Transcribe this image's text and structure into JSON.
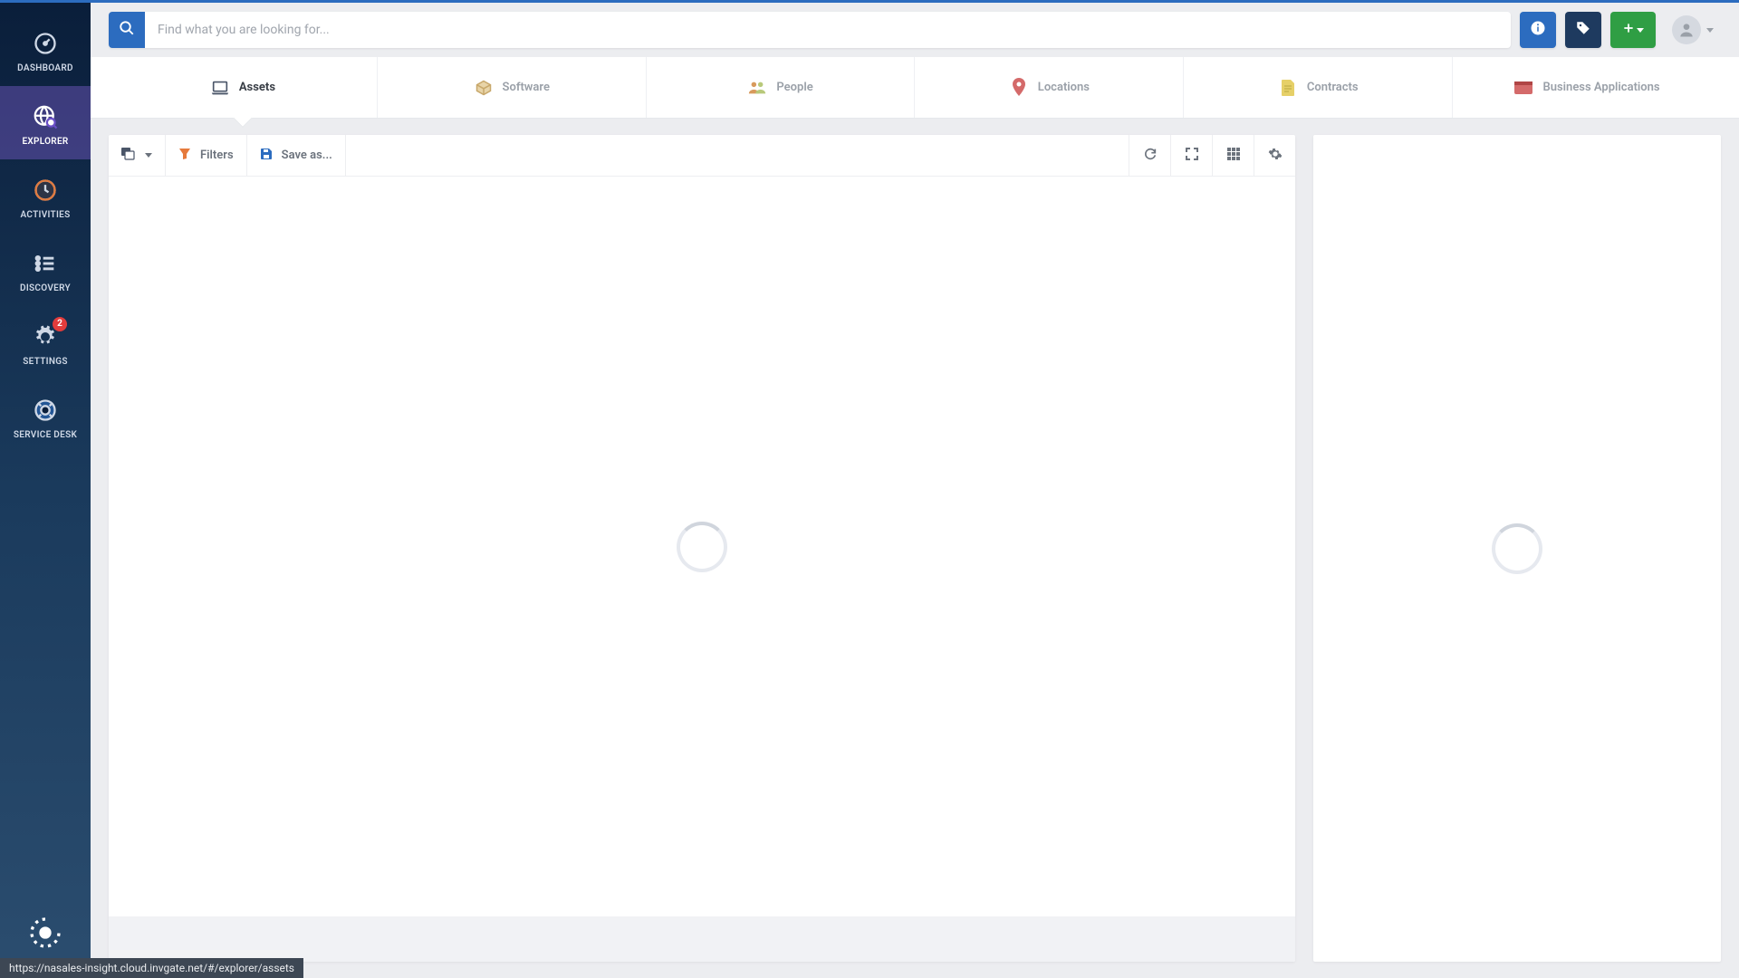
{
  "search": {
    "placeholder": "Find what you are looking for..."
  },
  "sidebar": {
    "items": [
      {
        "label": "DASHBOARD"
      },
      {
        "label": "EXPLORER"
      },
      {
        "label": "ACTIVITIES"
      },
      {
        "label": "DISCOVERY"
      },
      {
        "label": "SETTINGS",
        "badge": "2"
      },
      {
        "label": "SERVICE DESK"
      }
    ]
  },
  "category_tabs": {
    "items": [
      {
        "label": "Assets"
      },
      {
        "label": "Software"
      },
      {
        "label": "People"
      },
      {
        "label": "Locations"
      },
      {
        "label": "Contracts"
      },
      {
        "label": "Business Applications"
      }
    ]
  },
  "toolbar": {
    "filters_label": "Filters",
    "saveas_label": "Save as..."
  },
  "colors": {
    "primary": "#2c6cbf",
    "success": "#2f9e44",
    "danger": "#e23c3c"
  },
  "status_url": "https://nasales-insight.cloud.invgate.net/#/explorer/assets"
}
